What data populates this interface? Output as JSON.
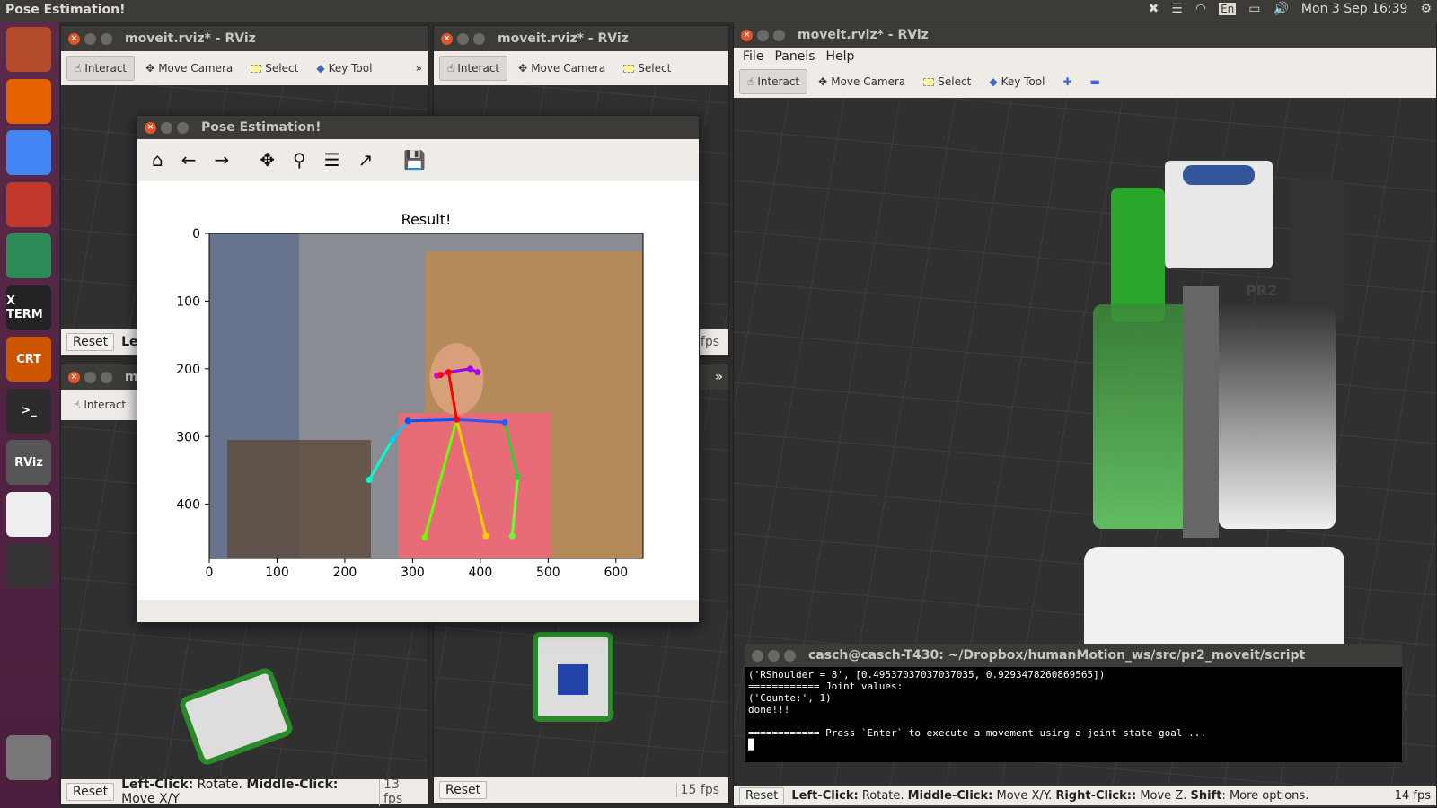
{
  "topbar": {
    "app_title": "Pose Estimation!",
    "keyboard_layout": "En",
    "clock": "Mon  3 Sep 16:39"
  },
  "launcher": {
    "items": [
      {
        "name": "ubuntu",
        "label": "",
        "color": "#b34a2a"
      },
      {
        "name": "firefox",
        "label": "",
        "color": "#e66000"
      },
      {
        "name": "chrome",
        "label": "",
        "color": "#4285f4"
      },
      {
        "name": "red-app",
        "label": "",
        "color": "#c0392b"
      },
      {
        "name": "atom",
        "label": "",
        "color": "#2e8b57"
      },
      {
        "name": "xterm",
        "label": "X TERM",
        "color": "#222"
      },
      {
        "name": "crt",
        "label": "CRT",
        "color": "#cc5500"
      },
      {
        "name": "terminal",
        "label": ">_",
        "color": "#2c2c2c"
      },
      {
        "name": "rviz",
        "label": "RViz",
        "color": "#555"
      },
      {
        "name": "pinwheel",
        "label": "",
        "color": "#eee"
      },
      {
        "name": "phone",
        "label": "",
        "color": "#333"
      },
      {
        "name": "trash",
        "label": "",
        "color": "#777"
      }
    ]
  },
  "rviz_windows": {
    "w1_title": "moveit.rviz* - RViz",
    "w2_title": "moveit.rviz* - RViz",
    "w3_title": "moveit.rviz* - RViz",
    "w4_title": "m",
    "tool_interact": "Interact",
    "tool_move_camera": "Move Camera",
    "tool_select": "Select",
    "tool_key": "Key Tool",
    "reset": "Reset",
    "left_frag": "Left",
    "fps_13": "13 fps",
    "fps_15": "15 fps",
    "fps_14": "14 fps",
    "fps_frag": "fps",
    "status_small_left": "Left-Click:",
    "status_small_rotate": " Rotate. ",
    "status_small_mid": "Middle-Click:",
    "status_small_move": " Move X/Y",
    "status_big_left": "Left-Click:",
    "status_big_rotate": " Rotate. ",
    "status_big_mid": "Middle-Click:",
    "status_big_move": " Move X/Y. ",
    "status_big_right": "Right-Click::",
    "status_big_movez": " Move Z. ",
    "status_big_shift": "Shift",
    "status_big_more": ": More options.",
    "menu_file": "File",
    "menu_panels": "Panels",
    "menu_help": "Help",
    "robot_label": "PR2"
  },
  "pose_window": {
    "title": "Pose Estimation!",
    "plot_title": "Result!"
  },
  "chart_data": {
    "type": "scatter",
    "title": "Result!",
    "xlabel": "",
    "ylabel": "",
    "xlim": [
      0,
      640
    ],
    "ylim": [
      480,
      0
    ],
    "xticks": [
      "0",
      "100",
      "200",
      "300",
      "400",
      "500",
      "600"
    ],
    "yticks": [
      "0",
      "100",
      "200",
      "300",
      "400"
    ],
    "keypoints": [
      {
        "x": 353,
        "y": 205
      },
      {
        "x": 365,
        "y": 275
      },
      {
        "x": 293,
        "y": 277
      },
      {
        "x": 270,
        "y": 305
      },
      {
        "x": 236,
        "y": 364
      },
      {
        "x": 436,
        "y": 279
      },
      {
        "x": 455,
        "y": 360
      },
      {
        "x": 447,
        "y": 447
      },
      {
        "x": 318,
        "y": 449
      },
      {
        "x": 408,
        "y": 447
      },
      {
        "x": 336,
        "y": 210
      },
      {
        "x": 341,
        "y": 209
      },
      {
        "x": 385,
        "y": 200
      },
      {
        "x": 396,
        "y": 205
      }
    ],
    "limbs": [
      {
        "from": 0,
        "to": 1,
        "color": "#ff0000"
      },
      {
        "from": 1,
        "to": 2,
        "color": "#0055ff"
      },
      {
        "from": 2,
        "to": 3,
        "color": "#00ccff"
      },
      {
        "from": 3,
        "to": 4,
        "color": "#00ffcc"
      },
      {
        "from": 1,
        "to": 5,
        "color": "#3355ff"
      },
      {
        "from": 5,
        "to": 6,
        "color": "#33cc33"
      },
      {
        "from": 6,
        "to": 7,
        "color": "#66ff33"
      },
      {
        "from": 1,
        "to": 8,
        "color": "#66ff00"
      },
      {
        "from": 1,
        "to": 9,
        "color": "#ffcc00"
      },
      {
        "from": 0,
        "to": 10,
        "color": "#cc00ff"
      },
      {
        "from": 0,
        "to": 12,
        "color": "#9900ff"
      },
      {
        "from": 12,
        "to": 13,
        "color": "#aa00ff"
      }
    ]
  },
  "terminal": {
    "title": "casch@casch-T430: ~/Dropbox/humanMotion_ws/src/pr2_moveit/script",
    "lines": [
      "('RShoulder = 8', [0.49537037037037035, 0.9293478260869565])",
      "============ Joint values:",
      "('Counte:', 1)",
      "done!!!",
      "",
      "============ Press `Enter` to execute a movement using a joint state goal ...",
      "█"
    ]
  }
}
